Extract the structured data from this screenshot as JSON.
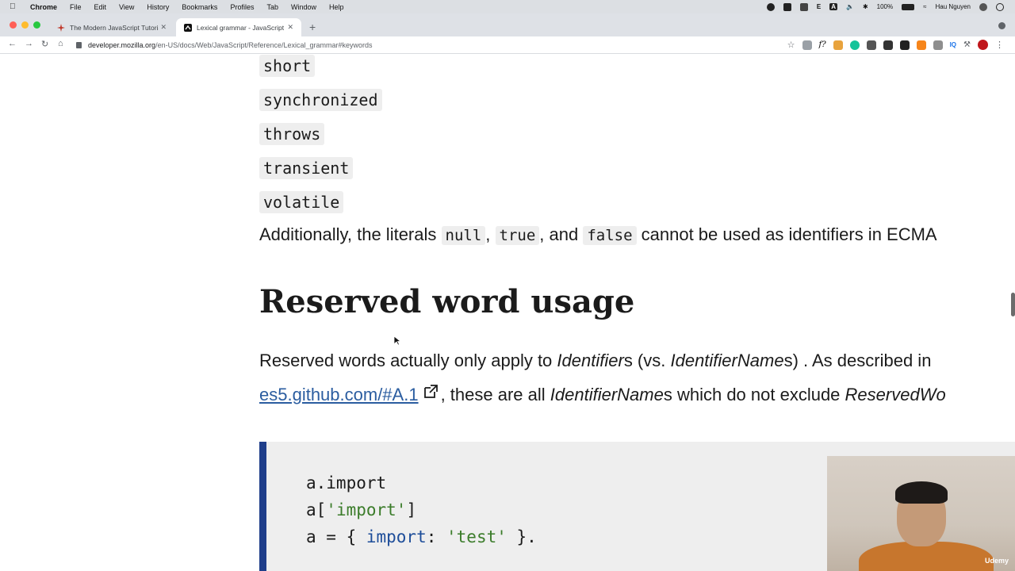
{
  "menubar": {
    "app": "Chrome",
    "items": [
      "File",
      "Edit",
      "View",
      "History",
      "Bookmarks",
      "Profiles",
      "Tab",
      "Window",
      "Help"
    ],
    "battery": "100%",
    "user": "Hau Nguyen",
    "status_letters": [
      "E",
      "A"
    ]
  },
  "tabs": [
    {
      "title": "The Modern JavaScript Tutorial",
      "active": false
    },
    {
      "title": "Lexical grammar - JavaScript | MDN",
      "active": true
    }
  ],
  "toolbar": {
    "url_host": "developer.mozilla.org",
    "url_path": "/en-US/docs/Web/JavaScript/Reference/Lexical_grammar#keywords"
  },
  "page": {
    "keywords": [
      "short",
      "synchronized",
      "throws",
      "transient",
      "volatile"
    ],
    "literals": {
      "prefix": "Additionally, the literals ",
      "null": "null",
      "sep1": ", ",
      "true": "true",
      "sep2": ", and ",
      "false": "false",
      "suffix": " cannot be used as identifiers in ECMA"
    },
    "heading": "Reserved word usage",
    "reserved": {
      "t1": "Reserved words actually only apply to ",
      "e1": "Identifier",
      "t2": "s (vs. ",
      "e2": "IdentifierName",
      "t3": "s) . As described in",
      "link": "es5.github.com/#A.1",
      "t4": ", these are all ",
      "e3": "IdentifierName",
      "t5": "s which do not exclude ",
      "e4": "ReservedWo"
    },
    "code": {
      "line1": "a.import",
      "line2_a": "a[",
      "line2_str": "'import'",
      "line2_b": "]",
      "line3_a": "a = { ",
      "line3_kw": "import",
      "line3_b": ": ",
      "line3_str": "'test'",
      "line3_c": " }."
    }
  },
  "webcam": {
    "brand": "Udemy"
  },
  "colors": {
    "link": "#2b5da0",
    "code_border": "#1f3e8a",
    "code_string": "#3b7c2a",
    "code_keyword": "#1d4d99"
  }
}
